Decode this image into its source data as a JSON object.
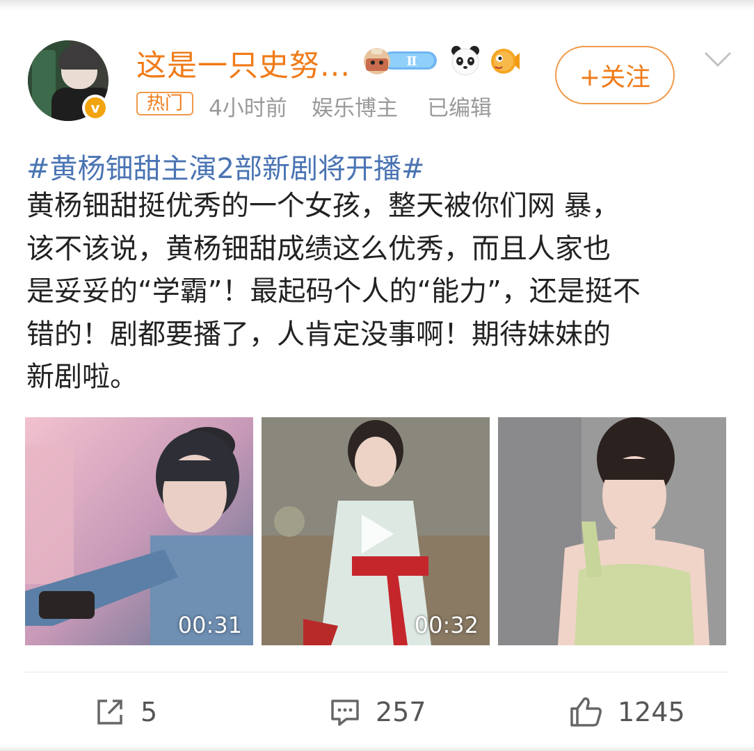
{
  "header": {
    "username": "这是一只史努...",
    "level_badge": "Ⅱ",
    "verified_badge": "v",
    "hot_tag": "热门",
    "time": "4小时前",
    "category": "娱乐博主",
    "edited": "已编辑",
    "follow_button": "+关注",
    "icons": [
      "level-badge-icon",
      "panda-icon",
      "pufferfish-icon",
      "chevron-down-icon"
    ]
  },
  "post": {
    "topic": "#黄杨钿甜主演2部新剧将开播#",
    "text": "黄杨钿甜挺优秀的一个女孩，整天被你们网 暴，\n该不该说，黄杨钿甜成绩这么优秀，而且人家也\n是妥妥的“学霸”！最起码个人的“能力”，还是挺不\n错的！剧都要播了，人肯定没事啊！期待妹妹的\n新剧啦。"
  },
  "media": [
    {
      "type": "video",
      "duration": "00:31"
    },
    {
      "type": "video",
      "duration": "00:32"
    },
    {
      "type": "image"
    }
  ],
  "actions": {
    "share_count": "5",
    "comment_count": "257",
    "like_count": "1245"
  },
  "colors": {
    "accent_orange": "#f07b18",
    "topic_blue": "#4a74b3",
    "meta_gray": "#9a9a9a"
  }
}
